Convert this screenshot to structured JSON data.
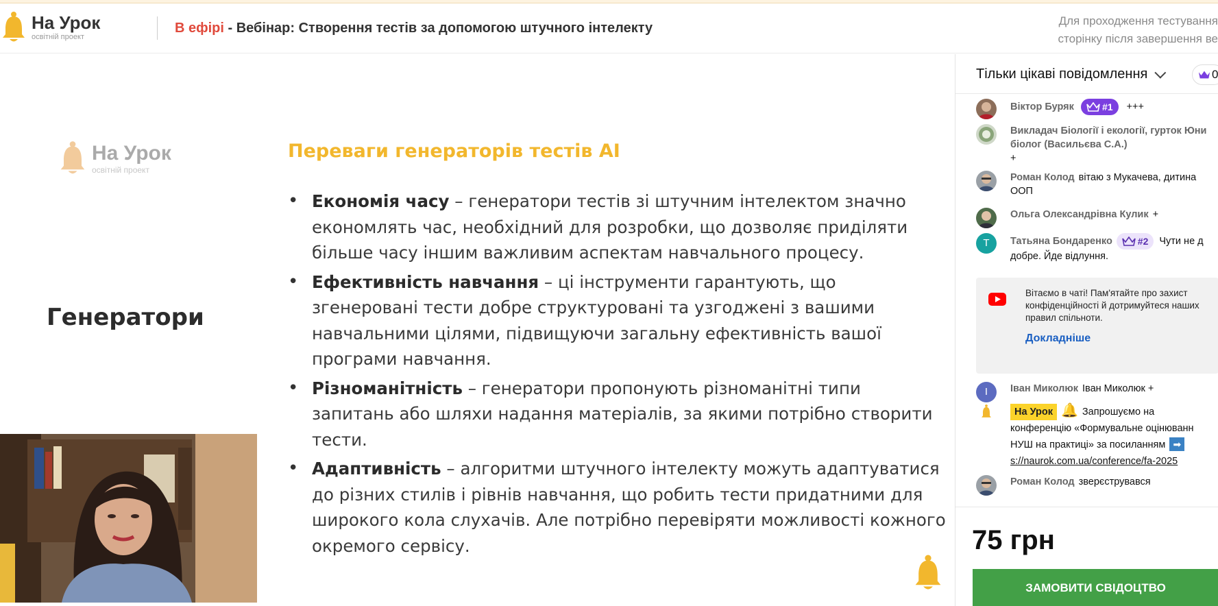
{
  "header": {
    "logo_title": "На Урок",
    "logo_subtitle": "освітній проект",
    "live_label": "В ефірі",
    "title_separator": " - ",
    "webinar_title": "Вебінар: Створення тестів за допомогою штучного інтелекту",
    "note_line1": "Для проходження тестування",
    "note_line2": "сторінку після завершення ве"
  },
  "slide": {
    "logo_title": "На Урок",
    "logo_subtitle": "освітній проект",
    "heading": "Переваги генераторів тестів AI",
    "left_title": "Генератори",
    "bullets": [
      {
        "term": "Економія часу",
        "text": " – генератори тестів зі штучним інтелектом значно економлять час, необхідний для розробки, що дозволяє приділяти більше часу іншим важливим аспектам навчального процесу."
      },
      {
        "term": "Ефективність навчання",
        "text": " – ці інструменти гарантують, що згенеровані тести добре структуровані та узгоджені з вашими навчальними цілями, підвищуючи загальну ефективність вашої програми навчання."
      },
      {
        "term": "Різноманітність",
        "text": " – генератори пропонують різноманітні типи запитань або шляхи надання матеріалів, за якими потрібно створити тести."
      },
      {
        "term": "Адаптивність",
        "text": " – алгоритми штучного інтелекту можуть адаптуватися до різних стилів і рівнів навчання, що робить тести придатними для широкого кола слухачів. Але потрібно перевіряти можливості кожного окремого сервісу."
      }
    ]
  },
  "chat": {
    "filter_label": "Тільки цікаві повідомлення",
    "top_count": "0",
    "messages": [
      {
        "author": "Віктор Буряк",
        "badge": "#1",
        "text": "+++"
      },
      {
        "author": "Викладач Біології і екології, гурток Юни",
        "author_line2": "біолог (Васильєва С.А.)",
        "text": "+"
      },
      {
        "author": "Роман Колод",
        "text": "вітаю з Мукачева, дитина",
        "text_line2": "ООП"
      },
      {
        "author": "Ольга Олександрівна Кулик",
        "text": "+"
      },
      {
        "author": "Татьяна Бондаренко",
        "avatar_letter": "Т",
        "badge": "#2",
        "text": "Чути не д",
        "text_line2": "добре. Йде відлуння."
      },
      {
        "author": "Іван Миколюк",
        "avatar_letter": "І",
        "text": "Іван Миколюк +"
      },
      {
        "author": "На Урок",
        "text": "Запрошуємо на",
        "text_line2": "конференцію «Формувальне оцінюванн",
        "text_line3": "НУШ на практиці» за посиланням",
        "link": "s://naurok.com.ua/conference/fa-2025"
      },
      {
        "author": "Роман Колод",
        "text": "зверєструвався"
      }
    ],
    "notice": {
      "line1": "Вітаємо в чаті! Пам'ятайте про захист",
      "line2": "конфіденційності й дотримуйтеся наших",
      "line3": "правил спільноти.",
      "link": "Докладніше"
    },
    "price": "75 грн",
    "order_button": "ЗАМОВИТИ СВІДОЦТВО"
  },
  "colors": {
    "accent_yellow": "#f2b72d",
    "live_red": "#e04a3c",
    "badge_purple": "#7b3fe0",
    "button_green": "#43a047",
    "link_blue": "#1a5fc2"
  }
}
